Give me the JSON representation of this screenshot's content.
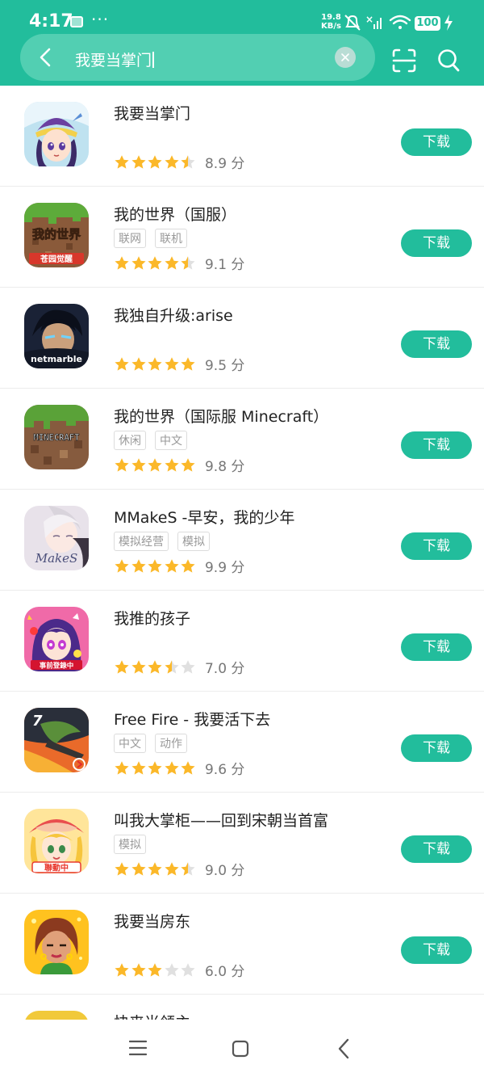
{
  "status_bar": {
    "time": "4:17",
    "more": "···",
    "net_speed_value": "19.8",
    "net_speed_unit": "KB/s",
    "battery": "100"
  },
  "search": {
    "query": "我要当掌门"
  },
  "apps": [
    {
      "name": "我要当掌门",
      "tags": [],
      "rating": 4.5,
      "score": "8.9 分",
      "button": "下载"
    },
    {
      "name": "我的世界（国服）",
      "tags": [
        "联网",
        "联机"
      ],
      "rating": 4.5,
      "score": "9.1 分",
      "button": "下载",
      "icon_text": [
        "我的世界",
        "苍园觉醒"
      ]
    },
    {
      "name": "我独自升级:arise",
      "tags": [],
      "rating": 5,
      "score": "9.5 分",
      "button": "下载",
      "icon_text": [
        "netmarble"
      ]
    },
    {
      "name": "我的世界（国际服 Minecraft）",
      "tags": [
        "休闲",
        "中文"
      ],
      "rating": 5,
      "score": "9.8 分",
      "button": "下载",
      "icon_text": [
        "MINECRAFT"
      ]
    },
    {
      "name": "MMakeS -早安，我的少年",
      "tags": [
        "模拟经营",
        "模拟"
      ],
      "rating": 5,
      "score": "9.9 分",
      "button": "下载",
      "icon_text": [
        "MakeS"
      ]
    },
    {
      "name": "我推的孩子",
      "tags": [],
      "rating": 3.5,
      "score": "7.0 分",
      "button": "下载",
      "icon_text": [
        "事前登錄中"
      ]
    },
    {
      "name": "Free Fire - 我要活下去",
      "tags": [
        "中文",
        "动作"
      ],
      "rating": 5,
      "score": "9.6 分",
      "button": "下载",
      "icon_text": [
        "7"
      ]
    },
    {
      "name": "叫我大掌柜——回到宋朝当首富",
      "tags": [
        "模拟"
      ],
      "rating": 4.5,
      "score": "9.0 分",
      "button": "下载",
      "icon_text": [
        "聯動中"
      ]
    },
    {
      "name": "我要当房东",
      "tags": [],
      "rating": 3,
      "score": "6.0 分",
      "button": "下载"
    },
    {
      "name": "快来当领主",
      "tags": [],
      "rating": 0,
      "score": "",
      "button": ""
    }
  ],
  "colors": {
    "accent": "#22bd9c",
    "star_filled": "#fbb829",
    "star_empty": "#e0e0e0"
  }
}
